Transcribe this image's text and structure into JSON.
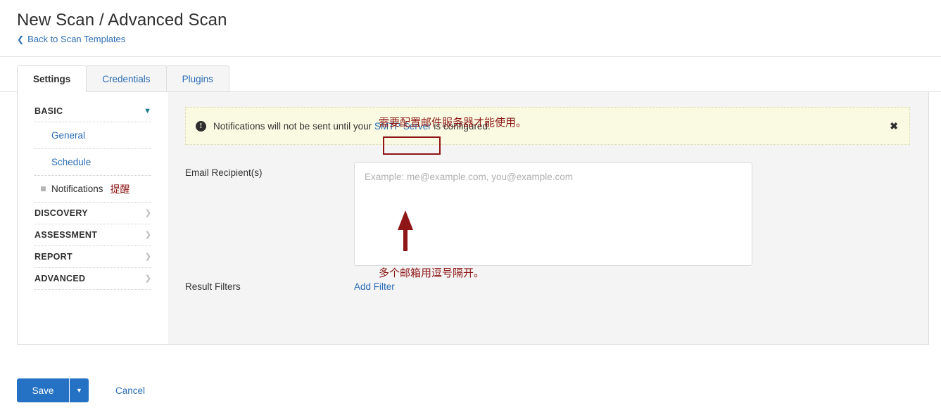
{
  "header": {
    "title": "New Scan / Advanced Scan",
    "back_link": "Back to Scan Templates",
    "back_chevron": "chevron-left-icon"
  },
  "tabs": [
    {
      "label": "Settings",
      "active": true
    },
    {
      "label": "Credentials",
      "active": false
    },
    {
      "label": "Plugins",
      "active": false
    }
  ],
  "sidebar": {
    "groups": [
      {
        "label": "BASIC",
        "expanded": true,
        "chevron": "chevron-down-icon"
      },
      {
        "label": "DISCOVERY",
        "expanded": false,
        "chevron": "chevron-right-icon"
      },
      {
        "label": "ASSESSMENT",
        "expanded": false,
        "chevron": "chevron-right-icon"
      },
      {
        "label": "REPORT",
        "expanded": false,
        "chevron": "chevron-right-icon"
      },
      {
        "label": "ADVANCED",
        "expanded": false,
        "chevron": "chevron-right-icon"
      }
    ],
    "basic_items": [
      {
        "label": "General",
        "selected": false
      },
      {
        "label": "Schedule",
        "selected": false
      },
      {
        "label": "Notifications",
        "selected": true
      }
    ],
    "notifications_annotation": "提醒"
  },
  "main": {
    "notice": {
      "icon": "exclamation-circle-icon",
      "text_before": "Notifications will not be sent until your ",
      "link": "SMTP Server",
      "text_after": " is configured.",
      "close_icon": "✖"
    },
    "email_recipients": {
      "label": "Email Recipient(s)",
      "placeholder": "Example: me@example.com, you@example.com",
      "value": ""
    },
    "result_filters": {
      "label": "Result Filters",
      "add_filter": "Add Filter"
    }
  },
  "annotations": {
    "smtp_note": "需要配置邮件服务器才能使用。",
    "email_note": "多个邮箱用逗号隔开。",
    "arrow": "up-arrow-annotation",
    "color": "#8e1616"
  },
  "footer": {
    "save": "Save",
    "save_caret": "caret-down-icon",
    "cancel": "Cancel"
  }
}
